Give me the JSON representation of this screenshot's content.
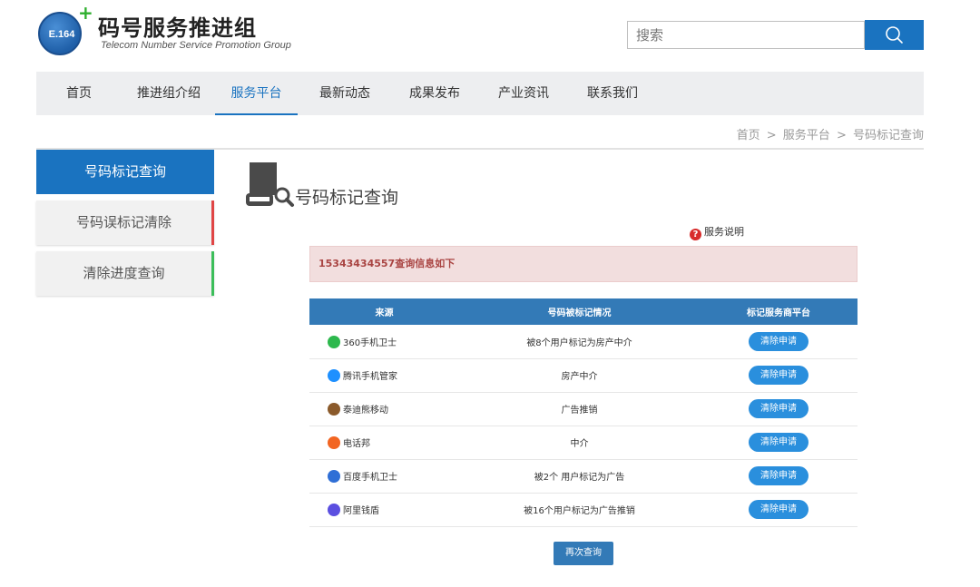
{
  "header": {
    "logo_badge": "E.164",
    "logo_plus": "+",
    "title_cn": "码号服务推进组",
    "title_en": "Telecom Number Service  Promotion Group",
    "search_placeholder": "搜索",
    "search_icon": "search-icon"
  },
  "nav": {
    "items": [
      {
        "label": "首页",
        "active": false
      },
      {
        "label": "推进组介绍",
        "active": false
      },
      {
        "label": "服务平台",
        "active": true
      },
      {
        "label": "最新动态",
        "active": false
      },
      {
        "label": "成果发布",
        "active": false
      },
      {
        "label": "产业资讯",
        "active": false
      },
      {
        "label": "联系我们",
        "active": false
      }
    ]
  },
  "breadcrumb": {
    "items": [
      "首页",
      "服务平台",
      "号码标记查询"
    ],
    "separator": ">"
  },
  "sidebar": {
    "items": [
      {
        "label": "号码标记查询",
        "active": true
      },
      {
        "label": "号码误标记清除",
        "accent": "#e04545"
      },
      {
        "label": "清除进度查询",
        "accent": "#3cbe5a"
      }
    ]
  },
  "main": {
    "page_icon": "document-search-icon",
    "title": "号码标记查询",
    "service_help": "服务说明",
    "alert": "15343434557查询信息如下",
    "table": {
      "headers": [
        "来源",
        "号码被标记情况",
        "标记服务商平台"
      ],
      "rows": [
        {
          "source": "360手机卫士",
          "icon": "shield-360-icon",
          "status": "被8个用户标记为房产中介",
          "action": "清除申请"
        },
        {
          "source": "腾讯手机管家",
          "icon": "tencent-guard-icon",
          "status": "房产中介",
          "action": "清除申请"
        },
        {
          "source": "泰迪熊移动",
          "icon": "teddy-bear-icon",
          "status": "广告推销",
          "action": "清除申请"
        },
        {
          "source": "电话邦",
          "icon": "dianhuabang-icon",
          "status": "中介",
          "action": "清除申请"
        },
        {
          "source": "百度手机卫士",
          "icon": "baidu-guard-icon",
          "status": "被2个 用户标记为广告",
          "action": "清除申请"
        },
        {
          "source": "阿里钱盾",
          "icon": "ali-shield-icon",
          "status": "被16个用户标记为广告推销",
          "action": "清除申请"
        }
      ]
    },
    "requery_button": "再次查询"
  },
  "colors": {
    "primary": "#1a73c0",
    "table_header": "#337ab7",
    "alert_bg": "#f2dede",
    "alert_text": "#a94442"
  }
}
